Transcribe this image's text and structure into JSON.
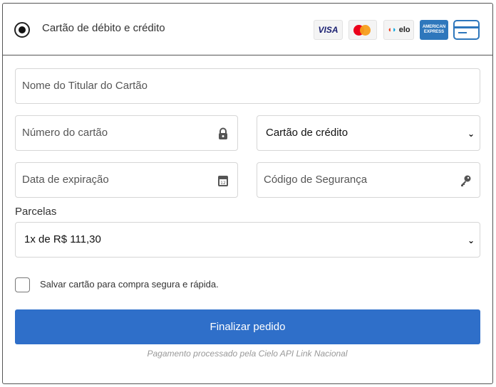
{
  "header": {
    "title": "Cartão de débito e crédito",
    "card_brands": {
      "visa": "VISA",
      "elo": "elo",
      "amex_line1": "AMERICAN",
      "amex_line2": "EXPRESS"
    },
    "colors": {
      "visa": "#1a1f71",
      "amex": "#2e77bc",
      "mastercard_red": "#eb001b",
      "mastercard_yellow": "#f79e1b"
    }
  },
  "form": {
    "holder_name_placeholder": "Nome do Titular do Cartão",
    "card_number_placeholder": "Número do cartão",
    "card_type_selected": "Cartão de crédito",
    "expiry_placeholder": "Data de expiração",
    "security_code_placeholder": "Código de Segurança",
    "installments_label": "Parcelas",
    "installments_selected": "1x de R$ 111,30",
    "save_card_label": "Salvar cartão para compra segura e rápida.",
    "submit_label": "Finalizar pedido",
    "footer_note": "Pagamento processado pela Cielo API Link Nacional"
  },
  "colors": {
    "primary": "#2f6fc9",
    "border": "#d6d6d6"
  }
}
